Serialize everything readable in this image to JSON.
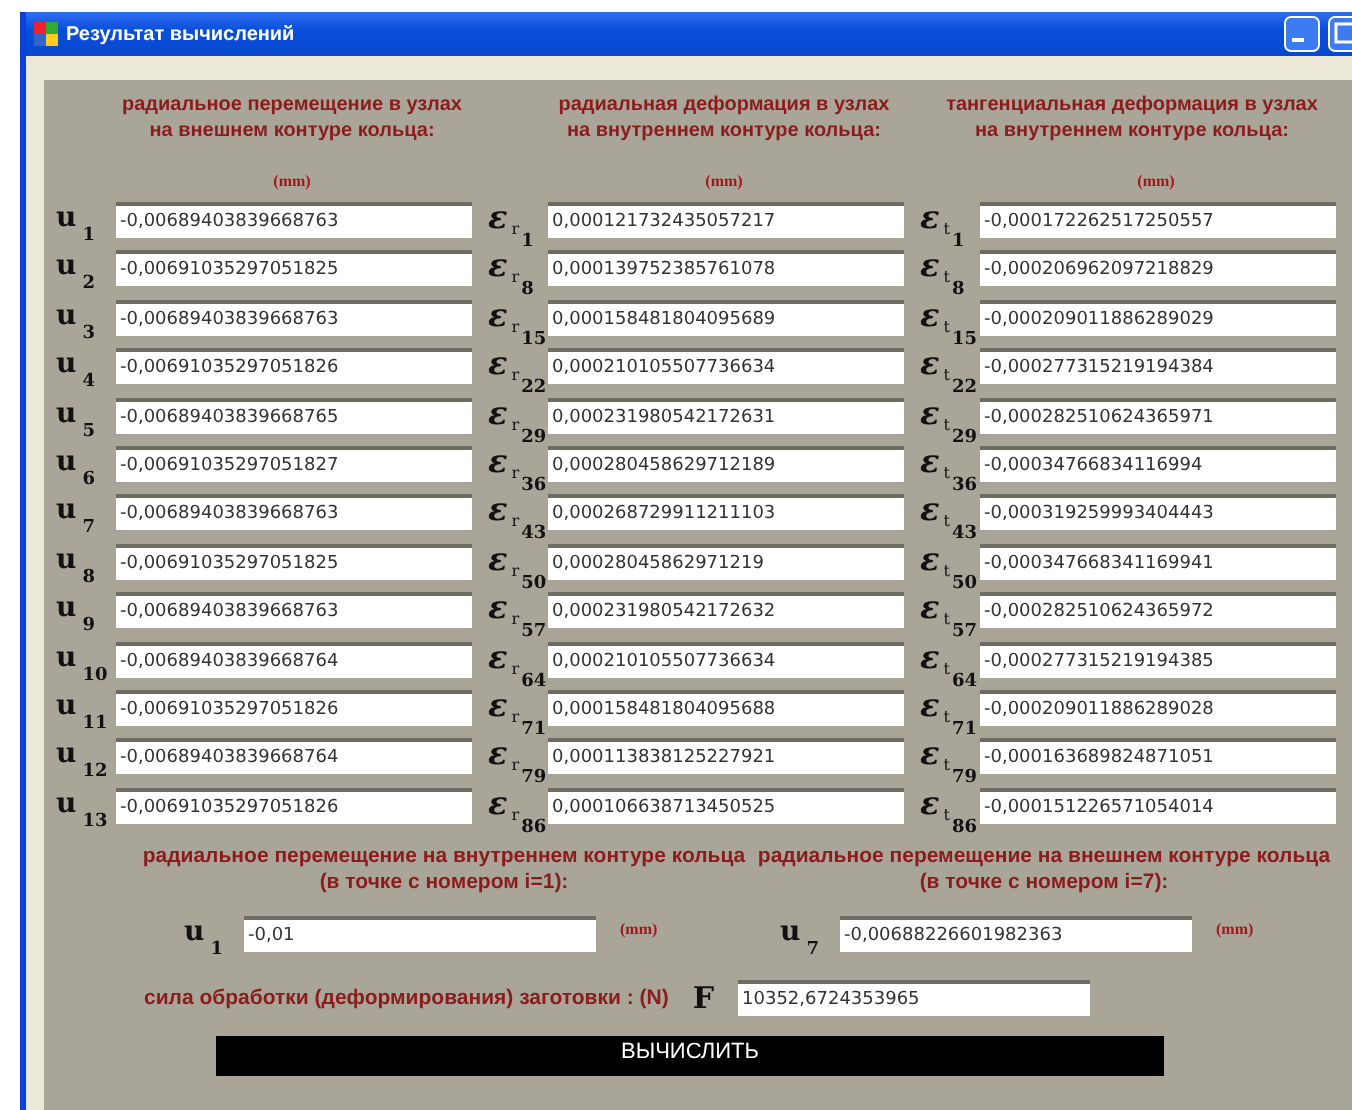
{
  "window": {
    "title": "Результат вычислений"
  },
  "columns": [
    {
      "heading": "радиальное перемещение в узлах\nна внешнем контуре кольца:",
      "unit": "(mm)",
      "rows": [
        {
          "symbol": "u",
          "index": "1",
          "value": "-0,00689403839668763"
        },
        {
          "symbol": "u",
          "index": "2",
          "value": "-0,00691035297051825"
        },
        {
          "symbol": "u",
          "index": "3",
          "value": "-0,00689403839668763"
        },
        {
          "symbol": "u",
          "index": "4",
          "value": "-0,00691035297051826"
        },
        {
          "symbol": "u",
          "index": "5",
          "value": "-0,00689403839668765"
        },
        {
          "symbol": "u",
          "index": "6",
          "value": "-0,00691035297051827"
        },
        {
          "symbol": "u",
          "index": "7",
          "value": "-0,00689403839668763"
        },
        {
          "symbol": "u",
          "index": "8",
          "value": "-0,00691035297051825"
        },
        {
          "symbol": "u",
          "index": "9",
          "value": "-0,00689403839668763"
        },
        {
          "symbol": "u",
          "index": "10",
          "value": "-0,00689403839668764"
        },
        {
          "symbol": "u",
          "index": "11",
          "value": "-0,00691035297051826"
        },
        {
          "symbol": "u",
          "index": "12",
          "value": "-0,00689403839668764"
        },
        {
          "symbol": "u",
          "index": "13",
          "value": "-0,00691035297051826"
        }
      ]
    },
    {
      "heading": "радиальная деформация в узлах\nна внутреннем контуре кольца:",
      "unit": "(mm)",
      "rows": [
        {
          "symbol": "ε",
          "sub": "r",
          "index": "1",
          "value": "0,000121732435057217"
        },
        {
          "symbol": "ε",
          "sub": "r",
          "index": "8",
          "value": "0,000139752385761078"
        },
        {
          "symbol": "ε",
          "sub": "r",
          "index": "15",
          "value": "0,000158481804095689"
        },
        {
          "symbol": "ε",
          "sub": "r",
          "index": "22",
          "value": "0,000210105507736634"
        },
        {
          "symbol": "ε",
          "sub": "r",
          "index": "29",
          "value": "0,000231980542172631"
        },
        {
          "symbol": "ε",
          "sub": "r",
          "index": "36",
          "value": "0,000280458629712189"
        },
        {
          "symbol": "ε",
          "sub": "r",
          "index": "43",
          "value": "0,000268729911211103"
        },
        {
          "symbol": "ε",
          "sub": "r",
          "index": "50",
          "value": "0,00028045862971219"
        },
        {
          "symbol": "ε",
          "sub": "r",
          "index": "57",
          "value": "0,000231980542172632"
        },
        {
          "symbol": "ε",
          "sub": "r",
          "index": "64",
          "value": "0,000210105507736634"
        },
        {
          "symbol": "ε",
          "sub": "r",
          "index": "71",
          "value": "0,000158481804095688"
        },
        {
          "symbol": "ε",
          "sub": "r",
          "index": "79",
          "value": "0,000113838125227921"
        },
        {
          "symbol": "ε",
          "sub": "r",
          "index": "86",
          "value": "0,000106638713450525"
        }
      ]
    },
    {
      "heading": "тангенциальная деформация в узлах\nна внутреннем контуре кольца:",
      "unit": "(mm)",
      "rows": [
        {
          "symbol": "ε",
          "sub": "t",
          "index": "1",
          "value": "-0,000172262517250557"
        },
        {
          "symbol": "ε",
          "sub": "t",
          "index": "8",
          "value": "-0,000206962097218829"
        },
        {
          "symbol": "ε",
          "sub": "t",
          "index": "15",
          "value": "-0,000209011886289029"
        },
        {
          "symbol": "ε",
          "sub": "t",
          "index": "22",
          "value": "-0,000277315219194384"
        },
        {
          "symbol": "ε",
          "sub": "t",
          "index": "29",
          "value": "-0,000282510624365971"
        },
        {
          "symbol": "ε",
          "sub": "t",
          "index": "36",
          "value": "-0,00034766834116994"
        },
        {
          "symbol": "ε",
          "sub": "t",
          "index": "43",
          "value": "-0,000319259993404443"
        },
        {
          "symbol": "ε",
          "sub": "t",
          "index": "50",
          "value": "-0,000347668341169941"
        },
        {
          "symbol": "ε",
          "sub": "t",
          "index": "57",
          "value": "-0,000282510624365972"
        },
        {
          "symbol": "ε",
          "sub": "t",
          "index": "64",
          "value": "-0,000277315219194385"
        },
        {
          "symbol": "ε",
          "sub": "t",
          "index": "71",
          "value": "-0,000209011886289028"
        },
        {
          "symbol": "ε",
          "sub": "t",
          "index": "79",
          "value": "-0,000163689824871051"
        },
        {
          "symbol": "ε",
          "sub": "t",
          "index": "86",
          "value": "-0,000151226571054014"
        }
      ]
    }
  ],
  "boundary": [
    {
      "heading": "радиальное перемещение на внутреннем контуре кольца\n(в точке с номером i=1):",
      "symbol": "u",
      "index": "1",
      "value": "-0,01",
      "unit": "(mm)"
    },
    {
      "heading": "радиальное перемещение на внешнем контуре кольца\n(в точке с номером i=7):",
      "symbol": "u",
      "index": "7",
      "value": "-0,00688226601982363",
      "unit": "(mm)"
    }
  ],
  "force": {
    "label": "сила обработки (деформирования) заготовки : (N)",
    "symbol": "F",
    "value": "10352,6724353965"
  },
  "button": {
    "label": "ВЫЧИСЛИТЬ"
  }
}
